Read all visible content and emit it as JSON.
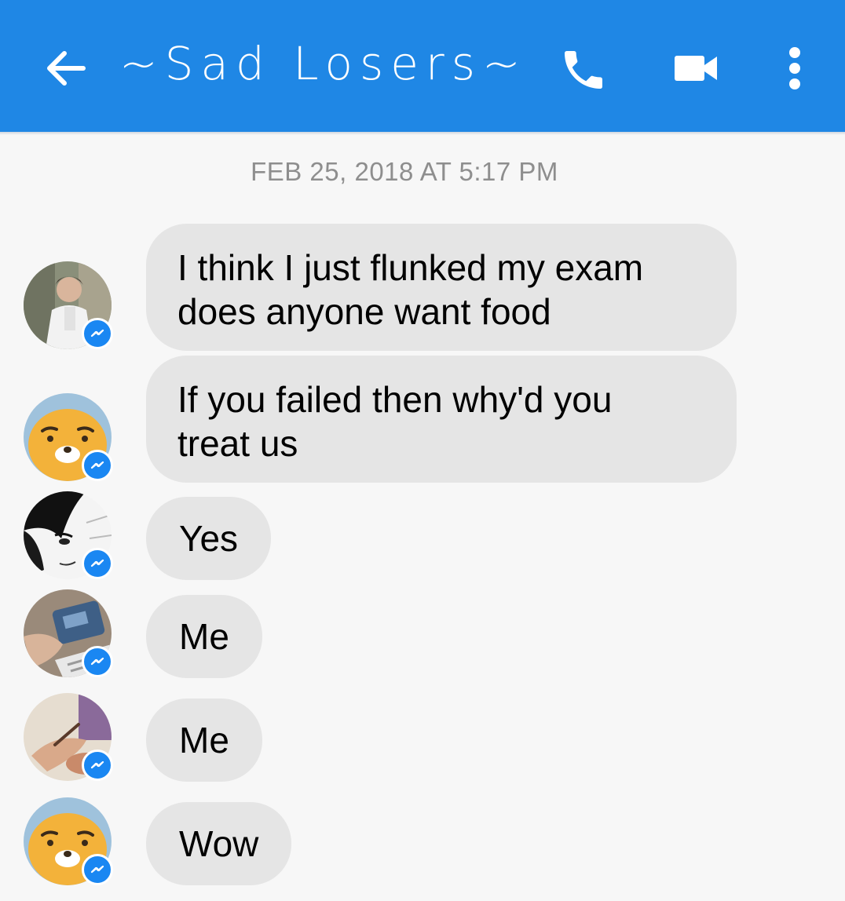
{
  "header": {
    "title": "~Sad Losers~",
    "back_icon": "back-arrow-icon",
    "call_icon": "phone-icon",
    "video_icon": "video-camera-icon",
    "menu_icon": "more-vert-icon",
    "bar_color": "#1f87e5"
  },
  "conversation": {
    "timestamp": "FEB 25, 2018 AT 5:17 PM",
    "messages": [
      {
        "text": "I think I just flunked my exam\ndoes anyone want food",
        "avatar": "photo-avatar"
      },
      {
        "text": "If you failed then why'd you\ntreat us",
        "avatar": "bear-avatar"
      },
      {
        "text": "Yes",
        "avatar": "manga-avatar"
      },
      {
        "text": "Me",
        "avatar": "photo-avatar"
      },
      {
        "text": "Me",
        "avatar": "photo-avatar"
      },
      {
        "text": "Wow",
        "avatar": "bear-avatar"
      }
    ],
    "bubble_color": "#e5e5e5",
    "badge_icon": "messenger-icon",
    "badge_color": "#1a87f2"
  }
}
